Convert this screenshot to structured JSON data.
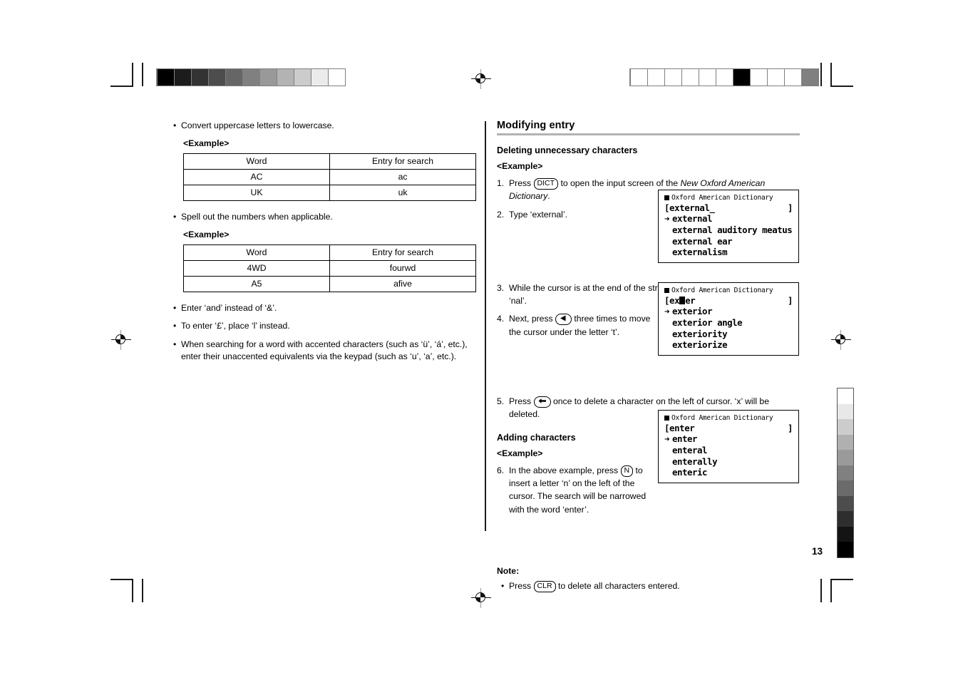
{
  "page": {
    "number": "13"
  },
  "left_column": {
    "bullets": [
      {
        "text": "Convert uppercase letters to lowercase."
      },
      {
        "text": "Spell out the numbers when applicable."
      },
      {
        "text": "Enter ‘and’ instead of ‘&’."
      },
      {
        "text": "To enter ‘£’, place ‘l’ instead."
      },
      {
        "text": "When searching for a word with accented characters (such as ‘ü’, ‘á’, etc.), enter their unaccented equivalents via the keypad (such as ‘u’, ‘a’, etc.)."
      }
    ],
    "example_label": "<Example>",
    "table1": {
      "headers": [
        "Word",
        "Entry for search"
      ],
      "rows": [
        [
          "AC",
          "ac"
        ],
        [
          "UK",
          "uk"
        ]
      ]
    },
    "table2": {
      "headers": [
        "Word",
        "Entry for search"
      ],
      "rows": [
        [
          "4WD",
          "fourwd"
        ],
        [
          "A5",
          "afive"
        ]
      ]
    }
  },
  "right_column": {
    "section_title": "Modifying entry",
    "subsection_1": {
      "title": "Deleting unnecessary characters",
      "example_label": "<Example>",
      "steps": [
        {
          "num": "1.",
          "part1": "Press",
          "key": "DICT",
          "part2": "to open the input screen of the",
          "italic": "New Oxford American Dictionary",
          "part3": "."
        },
        {
          "num": "2.",
          "part1": "Type ‘external’."
        },
        {
          "num": "3.",
          "part1": "While the cursor is at the end of the string, press",
          "key": "backspace-arrow-icon",
          "part2": "three times to delete ‘nal’."
        },
        {
          "num": "4.",
          "part1": "Next, press",
          "key": "left-triangle-arrow-icon",
          "part2": "three times to move the cursor under the letter ‘t’."
        },
        {
          "num": "5.",
          "part1": "Press",
          "key": "backspace-arrow-icon",
          "part2": "once to delete a character on the left of cursor. ‘x’ will be deleted."
        }
      ]
    },
    "subsection_2": {
      "title": "Adding characters",
      "example_label": "<Example>",
      "steps": [
        {
          "num": "6.",
          "part1": "In the above example, press",
          "key": "N",
          "part2": "to insert a letter ‘n’ on the left of the cursor. The search will be narrowed with the word ‘enter’."
        }
      ]
    },
    "note": {
      "heading": "Note:",
      "items": [
        {
          "part1": "Press",
          "key": "CLR",
          "part2": "to delete all characters entered."
        }
      ]
    }
  },
  "lcd_screens": [
    {
      "title": "Oxford American Dictionary",
      "input_text": "[external_",
      "input_close": "]",
      "entries": [
        {
          "marker": "➜",
          "text": "external"
        },
        {
          "marker": "",
          "text": "external auditory meatus"
        },
        {
          "marker": "",
          "text": "external ear"
        },
        {
          "marker": "",
          "text": "externalism"
        }
      ]
    },
    {
      "title": "Oxford American Dictionary",
      "input_prefix": "[ex",
      "input_suffix": "er",
      "input_close": "]",
      "entries": [
        {
          "marker": "➜",
          "text": "exterior"
        },
        {
          "marker": "",
          "text": "exterior angle"
        },
        {
          "marker": "",
          "text": "exteriority"
        },
        {
          "marker": "",
          "text": "exteriorize"
        }
      ]
    },
    {
      "title": "Oxford American Dictionary",
      "input_text": "[enter",
      "input_close": "]",
      "entries": [
        {
          "marker": "➜",
          "text": "enter"
        },
        {
          "marker": "",
          "text": "enteral"
        },
        {
          "marker": "",
          "text": "enterally"
        },
        {
          "marker": "",
          "text": "enteric"
        }
      ]
    }
  ],
  "print_marks": {
    "grayscale_left": [
      "#000000",
      "#1c1c1c",
      "#333333",
      "#4d4d4d",
      "#666666",
      "#808080",
      "#999999",
      "#b3b3b3",
      "#cccccc",
      "#ebebeb",
      "#ffffff"
    ],
    "grayscale_right": [
      "#ffffff",
      "#ffffff",
      "#ffffff",
      "#ffffff",
      "#ffffff",
      "#ffffff",
      "#000000",
      "#ffffff",
      "#ffffff",
      "#ffffff",
      "#808080"
    ],
    "grayscale_vertical": [
      "#ffffff",
      "#e8e8e8",
      "#cccccc",
      "#b0b0b0",
      "#9a9a9a",
      "#808080",
      "#6b6b6b",
      "#4d4d4d",
      "#2e2e2e",
      "#141414",
      "#000000"
    ]
  }
}
